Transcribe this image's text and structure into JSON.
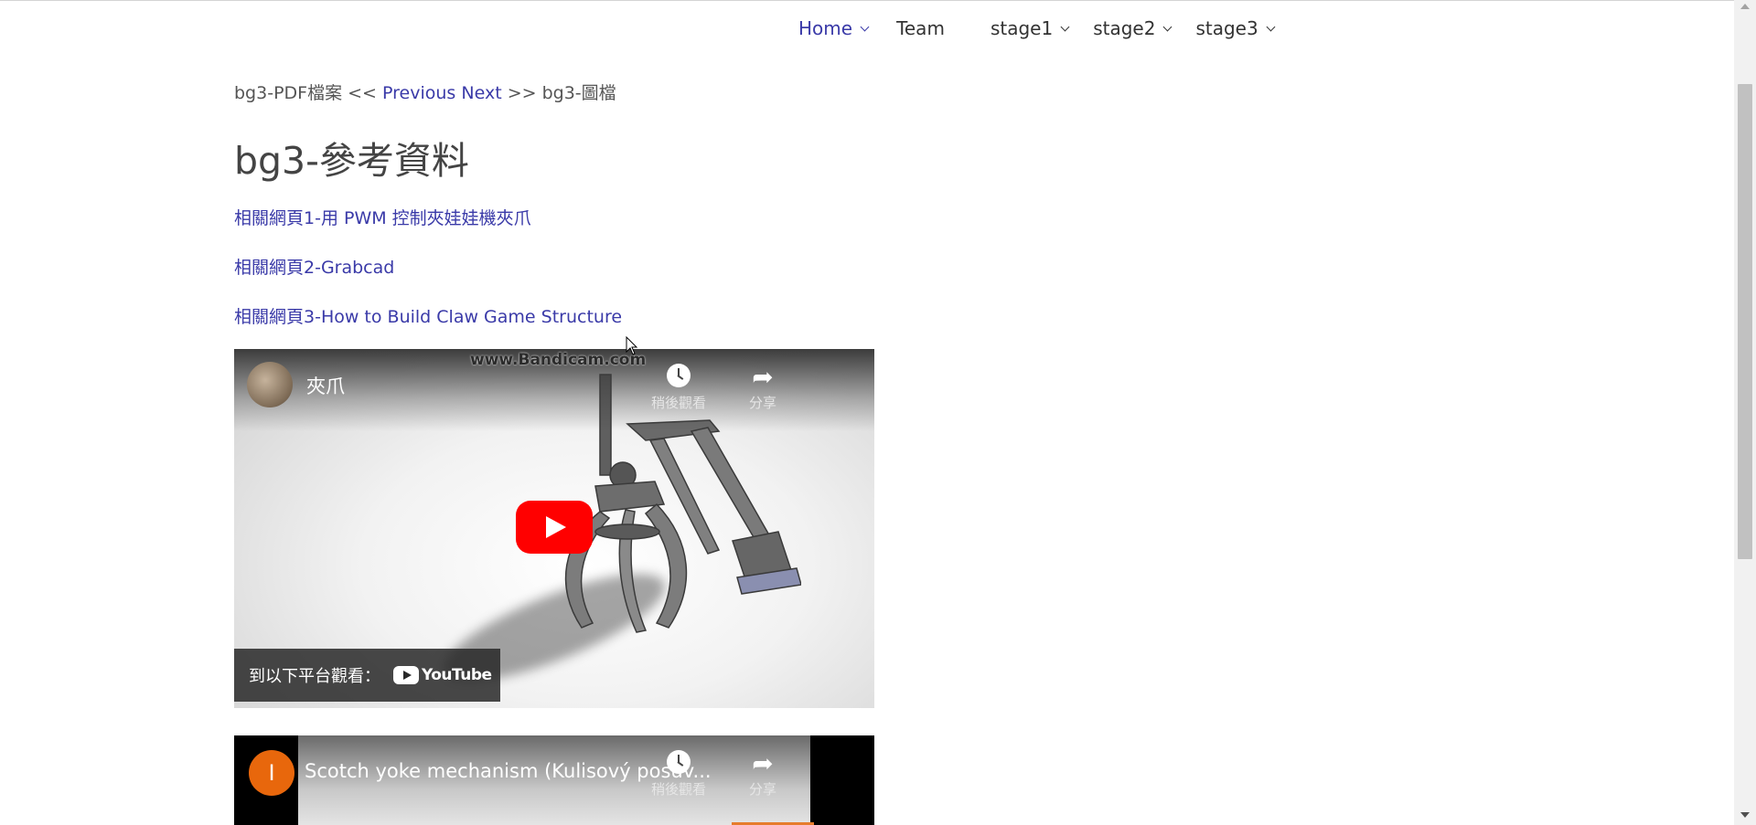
{
  "nav": {
    "items": [
      {
        "label": "Home",
        "dropdown": true,
        "active": true
      },
      {
        "label": "Team",
        "dropdown": false
      },
      {
        "label": "stage1",
        "dropdown": true
      },
      {
        "label": "stage2",
        "dropdown": true
      },
      {
        "label": "stage3",
        "dropdown": true
      }
    ]
  },
  "breadcrumb": {
    "prev_page": "bg3-PDF檔案",
    "prev_sep": "<<",
    "prev_label": "Previous",
    "next_label": "Next",
    "next_sep": ">>",
    "next_page": "bg3-圖檔"
  },
  "page_title": "bg3-參考資料",
  "links": [
    "相關網頁1-用 PWM 控制夾娃娃機夾爪",
    "相關網頁2-Grabcad",
    "相關網頁3-How to Build Claw Game Structure"
  ],
  "video1": {
    "title": "夾爪",
    "watermark": "www.Bandicam.com",
    "watch_later": "稍後觀看",
    "share": "分享",
    "watch_on": "到以下平台觀看：",
    "youtube": "YouTube"
  },
  "video2": {
    "avatar_letter": "I",
    "title": "Scotch yoke mechanism (Kulisový posuv...",
    "watch_later": "稍後觀看",
    "share": "分享"
  },
  "colors": {
    "link": "#3a3aa8",
    "text": "#444444",
    "youtube_red": "#ff0000"
  }
}
